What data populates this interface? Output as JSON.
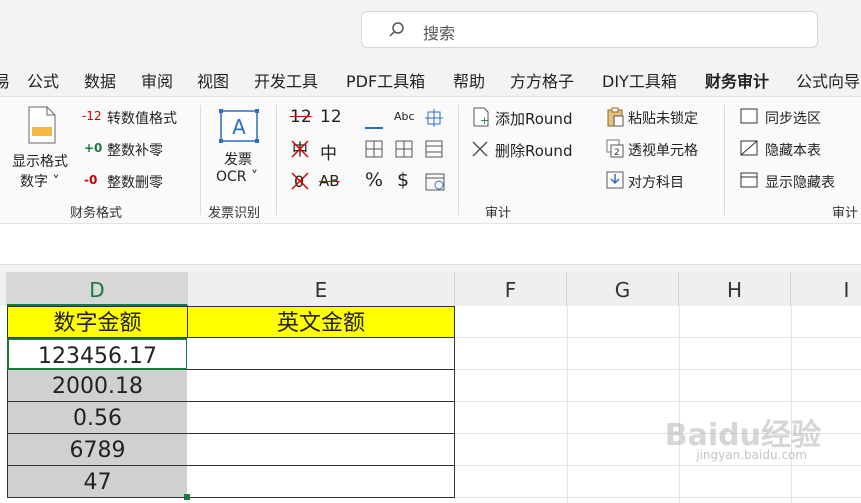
{
  "search": {
    "placeholder": "搜索",
    "icon": "search-icon"
  },
  "tabs": [
    "公式",
    "数据",
    "审阅",
    "视图",
    "开发工具",
    "PDF工具箱",
    "帮助",
    "方方格子",
    "DIY工具箱",
    "财务审计",
    "公式向导"
  ],
  "tab_fragment": "易",
  "active_tab": "财务审计",
  "ribbon": {
    "finance_format": {
      "big_button": [
        "显示格式",
        "数字 ˅"
      ],
      "items": [
        {
          "badge": "-12",
          "label": "转数值格式"
        },
        {
          "badge": "+0",
          "label": "整数补零"
        },
        {
          "badge": "-0",
          "label": "整数删零"
        }
      ],
      "group_label": "财务格式"
    },
    "invoice": {
      "big_button": [
        "发票",
        "OCR ˅"
      ],
      "group_label": "发票识别"
    },
    "audit": {
      "small_glyphs": [
        "12",
        "12",
        "中",
        "AB",
        "%",
        "$",
        "Abc"
      ],
      "round_items": [
        "添加Round",
        "删除Round"
      ],
      "lock_items": [
        "粘贴未锁定",
        "透视单元格",
        "对方科目"
      ],
      "group_label": "审计"
    },
    "sheet": {
      "items": [
        "同步选区",
        "隐藏本表",
        "显示隐藏表"
      ],
      "group_label": "审计"
    }
  },
  "columns": [
    "D",
    "E",
    "F",
    "G",
    "H",
    "I"
  ],
  "selected_column": "D",
  "table": {
    "headers": [
      "数字金额",
      "英文金额"
    ],
    "rows": [
      "123456.17",
      "2000.18",
      "0.56",
      "6789",
      "47"
    ]
  },
  "watermark": {
    "brand": "Baidu经验",
    "url": "jingyan.baidu.com"
  },
  "colors": {
    "accent": "#1a7a3c",
    "header_fill": "#ffff00",
    "selection_fill": "#d0d0d0"
  }
}
